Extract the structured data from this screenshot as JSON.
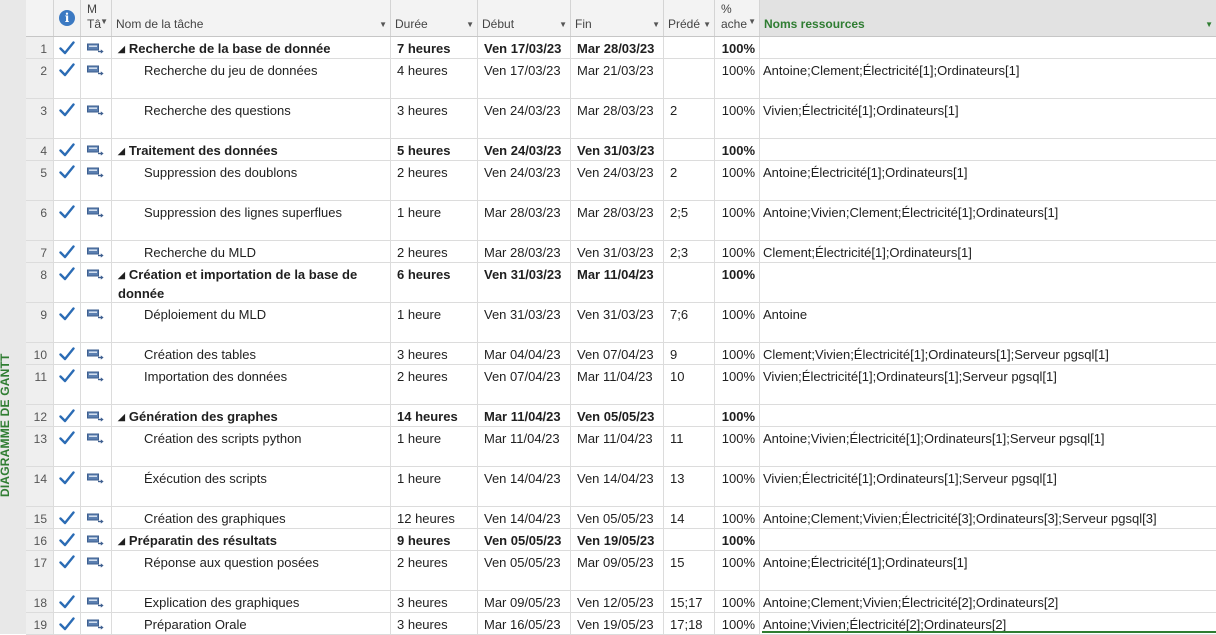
{
  "side_label": "DIAGRAMME DE GANTT",
  "columns": {
    "info": "i",
    "mode_a": "M",
    "mode_b": "Tâ",
    "name": "Nom de la tâche",
    "duration": "Durée",
    "start": "Début",
    "finish": "Fin",
    "pred": "Prédé",
    "pct_a": "%",
    "pct_b": "ache",
    "resources": "Noms ressources"
  },
  "colors": {
    "accent": "#2f7d32",
    "check": "#2b6cb5",
    "info": "#3b79c2"
  },
  "icons": {
    "check": "checkmark-icon",
    "mode": "auto-schedule-icon",
    "summary": "collapse-triangle-icon"
  },
  "rows": [
    {
      "id": "1",
      "name": "Recherche de la base de donnée",
      "name2": "",
      "summary": true,
      "duration": "7 heures",
      "start": "Ven 17/03/23",
      "finish": "Mar 28/03/23",
      "pred": "",
      "pct": "100%",
      "res": "",
      "h": 22
    },
    {
      "id": "2",
      "name": "Recherche du jeu de données",
      "name2": "",
      "summary": false,
      "duration": "4 heures",
      "start": "Ven 17/03/23",
      "finish": "Mar 21/03/23",
      "pred": "",
      "pct": "100%",
      "res": "Antoine;Clement;Électricité[1];Ordinateurs[1]",
      "h": 40
    },
    {
      "id": "3",
      "name": "Recherche des questions",
      "name2": "",
      "summary": false,
      "duration": "3 heures",
      "start": "Ven 24/03/23",
      "finish": "Mar 28/03/23",
      "pred": "2",
      "pct": "100%",
      "res": "Vivien;Électricité[1];Ordinateurs[1]",
      "h": 40
    },
    {
      "id": "4",
      "name": "Traitement des données",
      "name2": "",
      "summary": true,
      "duration": "5 heures",
      "start": "Ven 24/03/23",
      "finish": "Ven 31/03/23",
      "pred": "",
      "pct": "100%",
      "res": "",
      "h": 22
    },
    {
      "id": "5",
      "name": "Suppression des doublons",
      "name2": "",
      "summary": false,
      "duration": "2 heures",
      "start": "Ven 24/03/23",
      "finish": "Ven 24/03/23",
      "pred": "2",
      "pct": "100%",
      "res": "Antoine;Électricité[1];Ordinateurs[1]",
      "h": 40
    },
    {
      "id": "6",
      "name": "Suppression des lignes superflues",
      "name2": "",
      "summary": false,
      "duration": "1 heure",
      "start": "Mar 28/03/23",
      "finish": "Mar 28/03/23",
      "pred": "2;5",
      "pct": "100%",
      "res": "Antoine;Vivien;Clement;Électricité[1];Ordinateurs[1]",
      "h": 40
    },
    {
      "id": "7",
      "name": "Recherche du MLD",
      "name2": "",
      "summary": false,
      "duration": "2 heures",
      "start": "Mar 28/03/23",
      "finish": "Ven 31/03/23",
      "pred": "2;3",
      "pct": "100%",
      "res": "Clement;Électricité[1];Ordinateurs[1]",
      "h": 22
    },
    {
      "id": "8",
      "name": "Création et importation de la base de",
      "name2": "donnée",
      "summary": true,
      "duration": "6 heures",
      "start": "Ven 31/03/23",
      "finish": "Mar 11/04/23",
      "pred": "",
      "pct": "100%",
      "res": "",
      "h": 40
    },
    {
      "id": "9",
      "name": "Déploiement du MLD",
      "name2": "",
      "summary": false,
      "duration": "1 heure",
      "start": "Ven 31/03/23",
      "finish": "Ven 31/03/23",
      "pred": "7;6",
      "pct": "100%",
      "res": "Antoine",
      "h": 40
    },
    {
      "id": "10",
      "name": "Création des tables",
      "name2": "",
      "summary": false,
      "duration": "3 heures",
      "start": "Mar 04/04/23",
      "finish": "Ven 07/04/23",
      "pred": "9",
      "pct": "100%",
      "res": "Clement;Vivien;Électricité[1];Ordinateurs[1];Serveur pgsql[1]",
      "h": 22
    },
    {
      "id": "11",
      "name": "Importation des données",
      "name2": "",
      "summary": false,
      "duration": "2 heures",
      "start": "Ven 07/04/23",
      "finish": "Mar 11/04/23",
      "pred": "10",
      "pct": "100%",
      "res": "Vivien;Électricité[1];Ordinateurs[1];Serveur pgsql[1]",
      "h": 40
    },
    {
      "id": "12",
      "name": "Génération des graphes",
      "name2": "",
      "summary": true,
      "duration": "14 heures",
      "start": "Mar 11/04/23",
      "finish": "Ven 05/05/23",
      "pred": "",
      "pct": "100%",
      "res": "",
      "h": 22
    },
    {
      "id": "13",
      "name": "Création des scripts python",
      "name2": "",
      "summary": false,
      "duration": "1 heure",
      "start": "Mar 11/04/23",
      "finish": "Mar 11/04/23",
      "pred": "11",
      "pct": "100%",
      "res": "Antoine;Vivien;Électricité[1];Ordinateurs[1];Serveur pgsql[1]",
      "h": 40
    },
    {
      "id": "14",
      "name": "Éxécution des scripts",
      "name2": "",
      "summary": false,
      "duration": "1 heure",
      "start": "Ven 14/04/23",
      "finish": "Ven 14/04/23",
      "pred": "13",
      "pct": "100%",
      "res": "Vivien;Électricité[1];Ordinateurs[1];Serveur pgsql[1]",
      "h": 40
    },
    {
      "id": "15",
      "name": "Création des graphiques",
      "name2": "",
      "summary": false,
      "duration": "12 heures",
      "start": "Ven 14/04/23",
      "finish": "Ven 05/05/23",
      "pred": "14",
      "pct": "100%",
      "res": "Antoine;Clement;Vivien;Électricité[3];Ordinateurs[3];Serveur pgsql[3]",
      "h": 22
    },
    {
      "id": "16",
      "name": "Préparatin des résultats",
      "name2": "",
      "summary": true,
      "duration": "9 heures",
      "start": "Ven 05/05/23",
      "finish": "Ven 19/05/23",
      "pred": "",
      "pct": "100%",
      "res": "",
      "h": 22
    },
    {
      "id": "17",
      "name": "Réponse aux question posées",
      "name2": "",
      "summary": false,
      "duration": "2 heures",
      "start": "Ven 05/05/23",
      "finish": "Mar 09/05/23",
      "pred": "15",
      "pct": "100%",
      "res": "Antoine;Électricité[1];Ordinateurs[1]",
      "h": 40
    },
    {
      "id": "18",
      "name": "Explication des graphiques",
      "name2": "",
      "summary": false,
      "duration": "3 heures",
      "start": "Mar 09/05/23",
      "finish": "Ven 12/05/23",
      "pred": "15;17",
      "pct": "100%",
      "res": "Antoine;Clement;Vivien;Électricité[2];Ordinateurs[2]",
      "h": 22
    },
    {
      "id": "19",
      "name": "Préparation Orale",
      "name2": "",
      "summary": false,
      "duration": "3 heures",
      "start": "Mar 16/05/23",
      "finish": "Ven 19/05/23",
      "pred": "17;18",
      "pct": "100%",
      "res": "Antoine;Vivien;Électricité[2];Ordinateurs[2]",
      "h": 22
    }
  ]
}
